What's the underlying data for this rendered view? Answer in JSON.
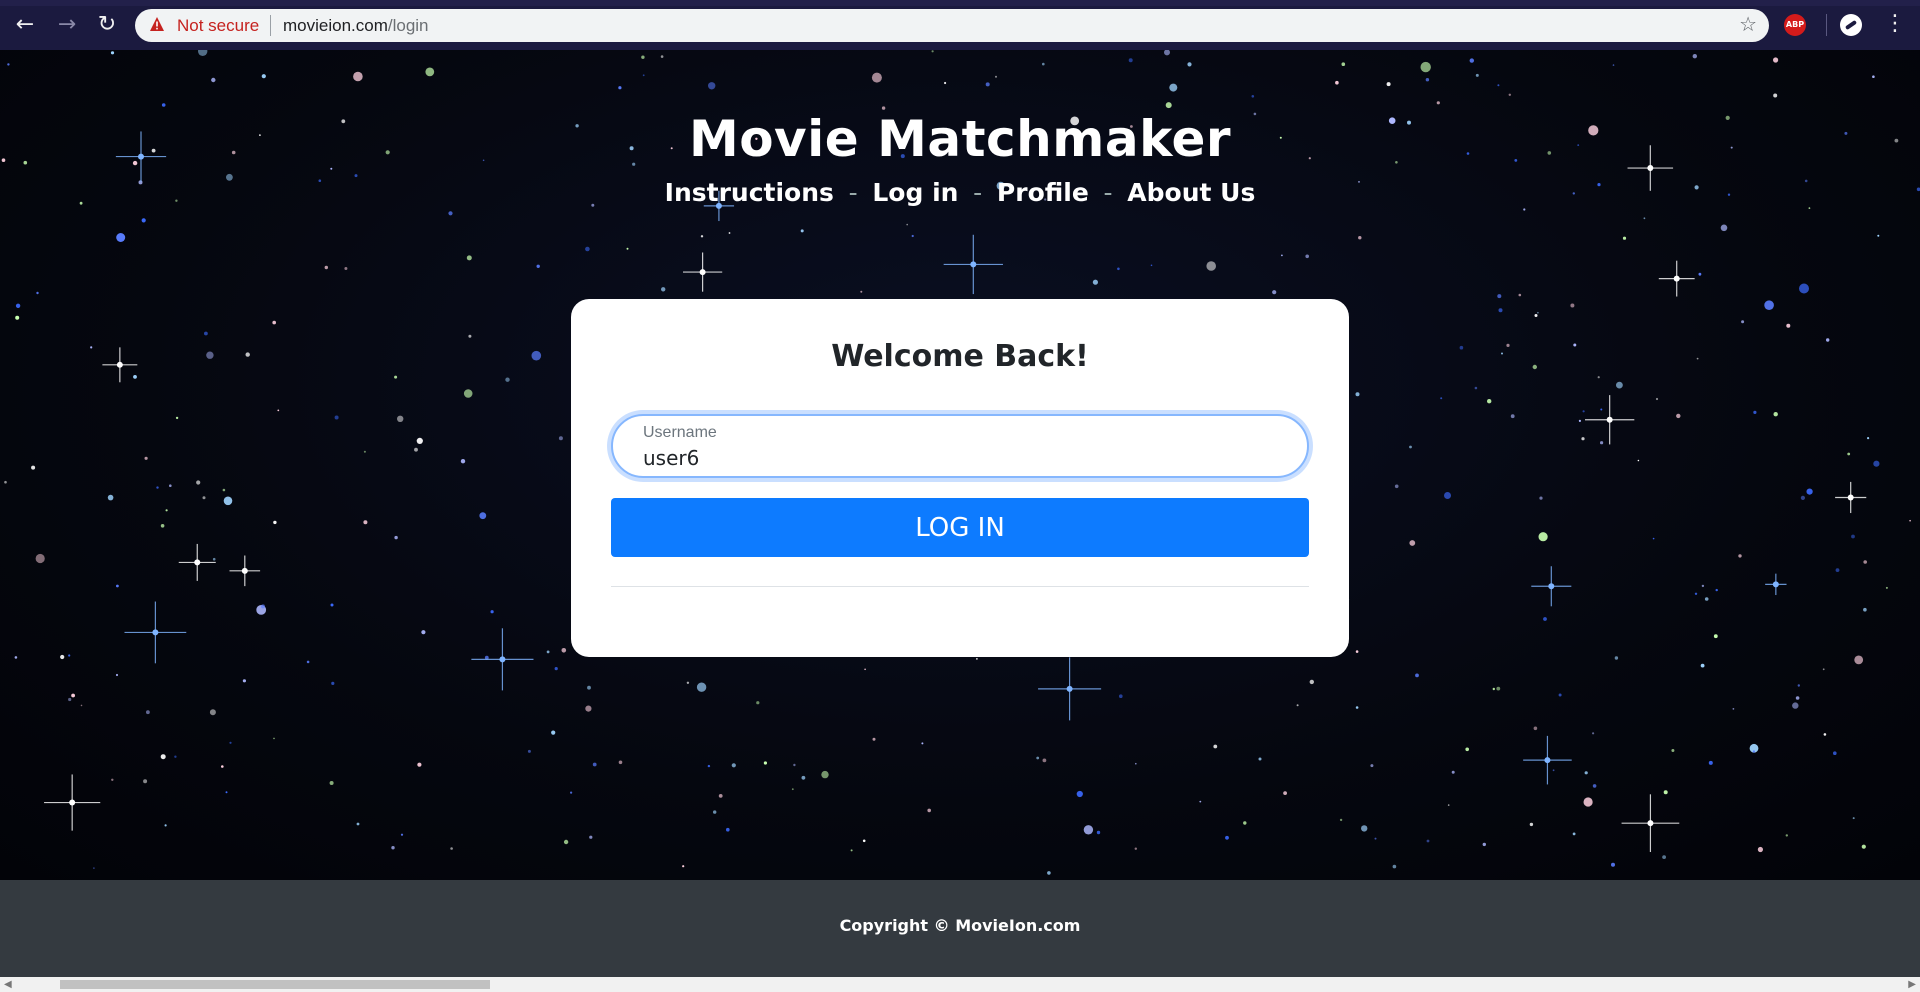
{
  "browser": {
    "back_icon": "←",
    "forward_icon": "→",
    "reload_icon": "↻",
    "security_label": "Not secure",
    "url_host": "movieion.com",
    "url_path": "/login",
    "bookmark_icon": "☆",
    "extension_abp_label": "ABP",
    "menu_icon": "⋮"
  },
  "site": {
    "title": "Movie Matchmaker",
    "nav": [
      {
        "label": "Instructions"
      },
      {
        "label": "Log in"
      },
      {
        "label": "Profile"
      },
      {
        "label": "About Us"
      }
    ],
    "nav_separator": "-"
  },
  "login": {
    "heading": "Welcome Back!",
    "username_label": "Username",
    "username_value": "user6",
    "submit_label": "LOG IN"
  },
  "footer": {
    "copyright": "Copyright © MovieIon.com"
  },
  "colors": {
    "primary_button": "#0d7bff",
    "footer_bg": "#343a40",
    "chrome_bg": "#1b1a3f",
    "warning_red": "#c5221f"
  }
}
